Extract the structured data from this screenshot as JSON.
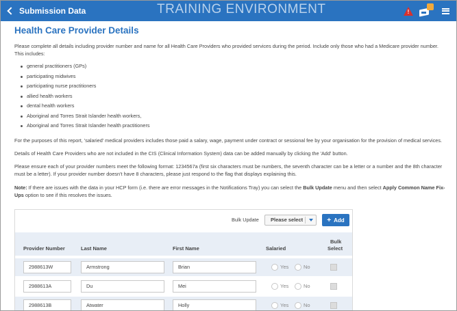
{
  "header": {
    "back_label": "Submission Data",
    "environment": "TRAINING ENVIRONMENT",
    "alert_mark": "!",
    "icons": [
      "chevron-left-icon",
      "warning-icon",
      "notification-tray-icon",
      "hamburger-menu-icon"
    ],
    "bar_color": "#2a73c0"
  },
  "main": {
    "title": "Health Care Provider Details",
    "intro": "Please complete all details including provider number and name for all Health Care Providers who provided services during the period. Include only those who had a Medicare provider number. This includes:",
    "list": [
      "general practitioners (GPs)",
      "participating midwives",
      "participating nurse practitioners",
      "allied health workers",
      "dental health workers",
      "Aboriginal and Torres Strait Islander health workers,",
      "Aboriginal and Torres Strait Islander health practitioners"
    ],
    "para_salaried": "For the purposes of this report, 'salaried' medical providers includes those paid a salary, wage, payment under contract or sessional fee by your organisation for the provision of medical services.",
    "para_cis": "Details of Health Care Providers who are not included in the CIS (Clinical Information System) data can be added manually by clicking the 'Add' button.",
    "para_format": "Please ensure each of your provider numbers meet the following format: 1234567a (first six characters must be numbers, the seventh character can be a letter or a number and the 8th character must be a letter). If your provider number doesn't have 8 characters, please just respond to the flag that displays explaining this.",
    "note": {
      "label": "Note:",
      "t1": " If there are issues with the data in your HCP form (i.e. there are error messages in the Notifications Tray) you can select the ",
      "b1": "Bulk Update",
      "t2": " menu and then select ",
      "b2": "Apply Common Name Fix-Ups",
      "t3": " option to see if this resolves the issues."
    }
  },
  "table": {
    "bulk_update_label": "Bulk Update",
    "bulk_select_value": "Please select",
    "add_label": "Add",
    "columns": {
      "provider_number": "Provider Number",
      "last_name": "Last Name",
      "first_name": "First Name",
      "salaried": "Salaried",
      "bulk_select_1": "Bulk",
      "bulk_select_2": "Select"
    },
    "yes_label": "Yes",
    "no_label": "No",
    "rows": [
      {
        "provider_number": "2988613W",
        "last_name": "Armstrong",
        "first_name": "Brian"
      },
      {
        "provider_number": "2988613A",
        "last_name": "Du",
        "first_name": "Mei"
      },
      {
        "provider_number": "2988613B",
        "last_name": "Atwater",
        "first_name": "Holly"
      }
    ]
  }
}
